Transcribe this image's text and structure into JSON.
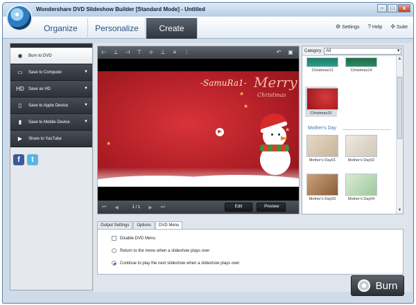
{
  "window": {
    "title": "Wondershare DVD Slideshow Builder [Standard Mode] - Untitled",
    "controls": {
      "minimize": "–",
      "maximize": "□",
      "close": "x"
    }
  },
  "header": {
    "tabs": [
      {
        "label": "Organize"
      },
      {
        "label": "Personalize"
      },
      {
        "label": "Create"
      }
    ],
    "links": [
      {
        "label": "Settings",
        "icon": "gear-icon"
      },
      {
        "label": "Help",
        "icon": "help-icon"
      },
      {
        "label": "Suite",
        "icon": "suite-icon"
      }
    ]
  },
  "sidebar": {
    "items": [
      {
        "label": "Burn to DVD",
        "icon": "dvd-icon"
      },
      {
        "label": "Save to Computer",
        "icon": "computer-icon"
      },
      {
        "label": "Save as HD",
        "icon": "hd-icon"
      },
      {
        "label": "Save to Apple Device",
        "icon": "apple-device-icon"
      },
      {
        "label": "Save to Mobile Device",
        "icon": "mobile-icon"
      },
      {
        "label": "Share to YouTube",
        "icon": "youtube-icon"
      }
    ],
    "social": {
      "facebook": "f",
      "twitter": "t"
    }
  },
  "preview": {
    "samurai_text": "-SamuRa1-",
    "merry_text": "Merry",
    "christmas_text": "Christmas",
    "page_indicator": "1 / 1",
    "edit_label": "Edit",
    "preview_label": "Preview"
  },
  "templates": {
    "category_label": "Category",
    "category_value": "All",
    "items": [
      {
        "label": "Christmas13"
      },
      {
        "label": "Christmas14"
      },
      {
        "label": "Christmas15"
      },
      {
        "label": "Mother's Day01"
      },
      {
        "label": "Mother's Day02"
      },
      {
        "label": "Mother's Day03"
      },
      {
        "label": "Mother's Day04"
      }
    ],
    "section_title": "Mother's Day"
  },
  "settings": {
    "tabs": [
      {
        "label": "Output Settings"
      },
      {
        "label": "Options"
      },
      {
        "label": "DVD Menu"
      }
    ],
    "disable_menu": "Disable DVD Menu",
    "return_option": "Return to the menu when a slideshow plays over",
    "continue_option": "Continue to play the next slideshow when a slideshow plays over"
  },
  "burn": {
    "label": "Burn"
  }
}
